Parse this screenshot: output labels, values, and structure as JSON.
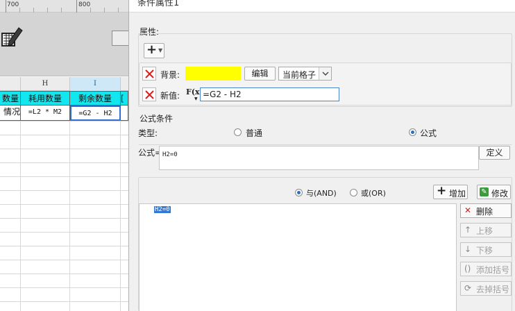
{
  "sheet": {
    "ruler_marks": [
      "700",
      "800"
    ],
    "columns": [
      "H",
      "I"
    ],
    "header_cells": [
      "数量",
      "耗用数量",
      "剩余数量",
      "["
    ],
    "formula_cells": [
      "情况",
      "=L2 * M2",
      "=G2 - H2",
      ""
    ]
  },
  "dialog": {
    "title": "条件属性1",
    "properties": {
      "label": "属性:",
      "add_button": "+",
      "background_label": "背景:",
      "background_color": "#ffff00",
      "edit_button": "编辑",
      "scope_select": "当前格子",
      "new_value_label": "新值:",
      "fx_label": "F(x)",
      "new_value": "=G2 - H2"
    },
    "formula_condition": {
      "label": "公式条件",
      "type_label": "类型:",
      "option_normal": "普通",
      "option_formula": "公式",
      "formula_label": "公式=",
      "formula_value": "H2=0",
      "define_button": "定义",
      "and_option": "与(AND)",
      "or_option": "或(OR)",
      "add_button": "增加",
      "modify_button": "修改",
      "conditions": [
        "H2=0"
      ],
      "delete_button": "删除",
      "move_up_button": "上移",
      "move_down_button": "下移",
      "add_bracket_button": "添加括号",
      "remove_bracket_button": "去掉括号"
    }
  }
}
